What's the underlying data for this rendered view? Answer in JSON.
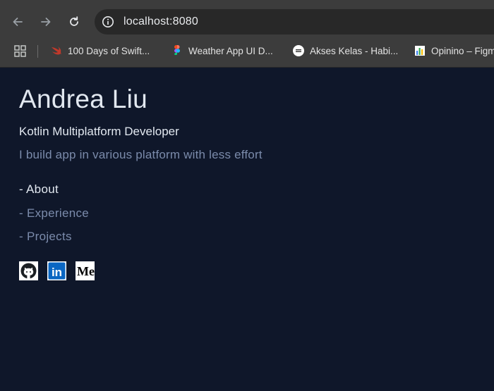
{
  "browser": {
    "url": "localhost:8080",
    "bookmarks": [
      {
        "label": "100 Days of Swift...",
        "icon": "swift-icon"
      },
      {
        "label": "Weather App UI D...",
        "icon": "figma-icon"
      },
      {
        "label": "Akses Kelas - Habi...",
        "icon": "habit-icon"
      },
      {
        "label": "Opinino – Figm",
        "icon": "chart-bars-icon"
      }
    ]
  },
  "profile": {
    "name": "Andrea Liu",
    "role": "Kotlin Multiplatform Developer",
    "tagline": "I build app in various platform with less effort"
  },
  "nav": {
    "items": [
      {
        "label": "- About",
        "active": true
      },
      {
        "label": "- Experience",
        "active": false
      },
      {
        "label": "- Projects",
        "active": false
      }
    ]
  },
  "social": {
    "items": [
      "github-icon",
      "linkedin-icon",
      "medium-icon"
    ],
    "linkedin_text": "in",
    "medium_text": "Me"
  },
  "colors": {
    "background": "#0f172a",
    "primary_text": "#e2e8f0",
    "muted_text": "#7b8bab"
  }
}
